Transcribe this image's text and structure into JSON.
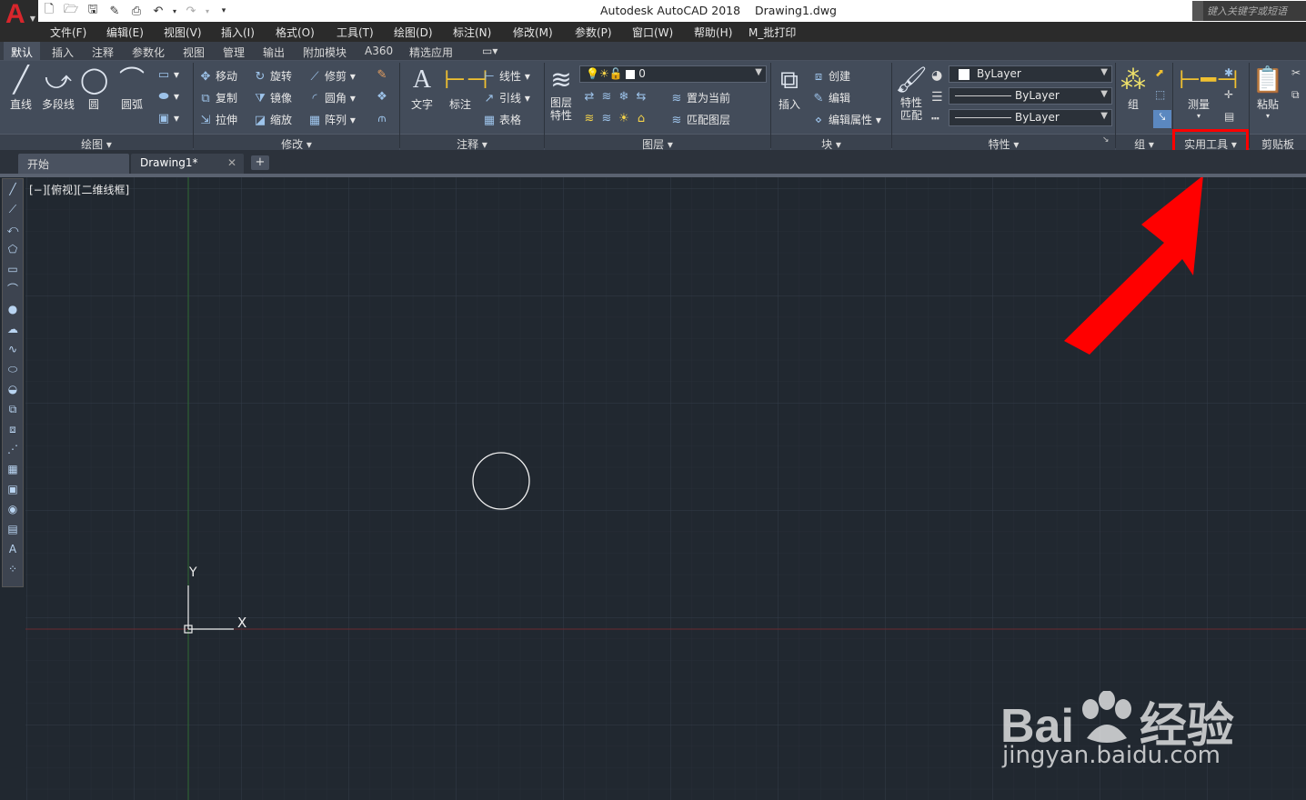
{
  "titlebar": {
    "app_title": "Autodesk AutoCAD 2018",
    "file_name": "Drawing1.dwg",
    "search_placeholder": "键入关键字或短语"
  },
  "menu": [
    "文件(F)",
    "编辑(E)",
    "视图(V)",
    "插入(I)",
    "格式(O)",
    "工具(T)",
    "绘图(D)",
    "标注(N)",
    "修改(M)",
    "参数(P)",
    "窗口(W)",
    "帮助(H)",
    "M_批打印"
  ],
  "ribbon_tabs": [
    "默认",
    "插入",
    "注释",
    "参数化",
    "视图",
    "管理",
    "输出",
    "附加模块",
    "A360",
    "精选应用"
  ],
  "draw_panel": {
    "title": "绘图",
    "buttons": [
      "直线",
      "多段线",
      "圆",
      "圆弧"
    ]
  },
  "modify_panel": {
    "title": "修改",
    "items": [
      "移动",
      "旋转",
      "修剪",
      "复制",
      "镜像",
      "圆角",
      "拉伸",
      "缩放",
      "阵列"
    ]
  },
  "annotation_panel": {
    "title": "注释",
    "big": [
      "文字",
      "标注"
    ],
    "items": [
      "线性",
      "引线",
      "表格"
    ]
  },
  "layers_panel": {
    "title": "图层",
    "big": "图层\n特性",
    "layer_value": "0",
    "items": [
      "置为当前",
      "匹配图层"
    ]
  },
  "block_panel": {
    "title": "块",
    "big": "插入",
    "items": [
      "创建",
      "编辑",
      "编辑属性"
    ]
  },
  "properties_panel": {
    "title": "特性",
    "big": "特性\n匹配",
    "color": "ByLayer",
    "linetype": "ByLayer",
    "lineweight": "ByLayer"
  },
  "group_panel": {
    "title": "组",
    "big": "组"
  },
  "utilities_panel": {
    "title": "实用工具",
    "big": "测量"
  },
  "clipboard_panel": {
    "title": "剪贴板",
    "big": "粘贴"
  },
  "file_tabs": [
    "开始",
    "Drawing1*"
  ],
  "viewport_label": "[−][俯视][二维线框]",
  "ucs": {
    "x_label": "X",
    "y_label": "Y"
  },
  "watermark": {
    "brand": "Bai du 经验",
    "url": "jingyan.baidu.com"
  },
  "colors": {
    "canvas": "#212830",
    "grid_minor": "#262d36",
    "grid_major": "#313a46",
    "highlight": "#ff0000",
    "arrow": "#ff0000"
  }
}
